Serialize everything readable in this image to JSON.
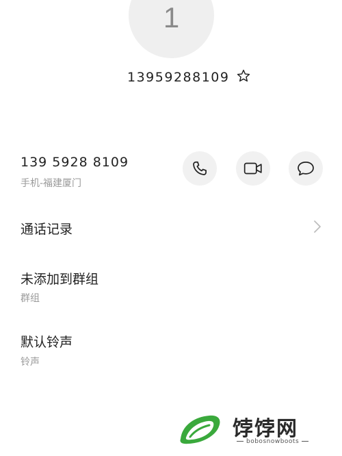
{
  "contact": {
    "avatar_letter": "1",
    "name": "13959288109",
    "favorite_icon": "star-icon"
  },
  "phone": {
    "number": "139 5928 8109",
    "label": "手机-福建厦门",
    "actions": [
      {
        "icon": "phone-icon"
      },
      {
        "icon": "video-icon"
      },
      {
        "icon": "message-icon"
      }
    ]
  },
  "rows": [
    {
      "title": "通话记录",
      "subtitle": "",
      "icon": "chevron-right-icon"
    },
    {
      "title": "未添加到群组",
      "subtitle": "群组"
    },
    {
      "title": "默认铃声",
      "subtitle": "铃声"
    }
  ],
  "watermark": {
    "title": "饽饽网",
    "url": "bobosnowboots",
    "colors": {
      "green": "#3aa93c",
      "dark": "#2a2a2a"
    }
  }
}
